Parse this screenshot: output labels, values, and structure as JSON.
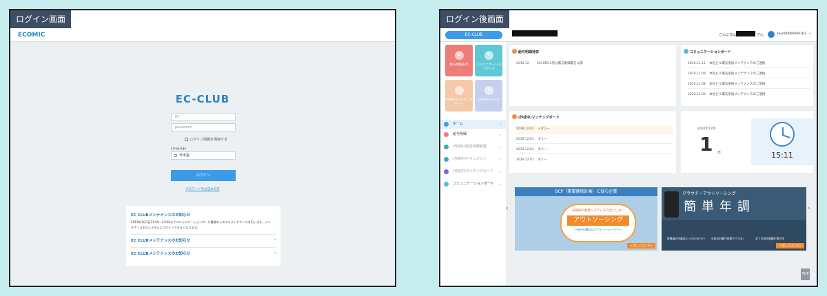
{
  "left": {
    "tag": "ログイン画面",
    "logo": "ECOMIC",
    "title": "EC-CLUB",
    "id_placeholder": "ID",
    "password_placeholder": "password",
    "remember_label": "ログイン情報を保持する",
    "language_label": "Language",
    "language_value": "日本語",
    "login_button": "ログイン",
    "forgot_link": "パスワードをお忘れの方",
    "notices": [
      {
        "title": "EC CLUBメンテナンスのお知らせ",
        "body": "2019年1月1日21:00〜24:00までコミュニケーションボード機能のシステムメンテナンスを行います。メンテナンス中はシステムにログインできなくなります。"
      },
      {
        "title": "EC CLUBメンテナンスのお知らせ"
      },
      {
        "title": "EC CLUBメンテナンスのお知らせ"
      }
    ]
  },
  "right": {
    "tag": "ログイン後画面",
    "brand": "EC-CLUB",
    "greeting_prefix": "こんにちは",
    "greeting_suffix": "さん",
    "user_id": "feu000000000163",
    "tiles": [
      {
        "label": "給与明細表示",
        "color": "#ee7c79",
        "icon": "yen-icon"
      },
      {
        "label": "コミュニケーションボード",
        "color": "#5fc8d3",
        "icon": "megaphone-icon"
      },
      {
        "label": "(作成中)マッチングボード",
        "color": "#f5c9a7",
        "icon": "chat-icon"
      },
      {
        "label": "(作成中)ヘルプ",
        "color": "#c5d0ef",
        "icon": "info-icon"
      }
    ],
    "nav": [
      {
        "label": "ホーム",
        "color": "#3c9be8",
        "active": true
      },
      {
        "label": "給与明細",
        "color": "#ee7c79"
      },
      {
        "label": "(作成中)勤怠情報管理",
        "color": "#35b3a7"
      },
      {
        "label": "(作成中)ドキュメント",
        "color": "#35b3a7"
      },
      {
        "label": "(作成中)マッチングボード",
        "color": "#6c6be0"
      },
      {
        "label": "コミュニケーションボード",
        "color": "#5fb3e5"
      }
    ],
    "payslip": {
      "title": "給与明細発表",
      "rows": [
        {
          "date": "2019.12",
          "text": "2019年12月分賞与明細書を公開"
        }
      ]
    },
    "comm": {
      "title": "コミュニケーションボード",
      "rows": [
        {
          "date": "2020.11.11",
          "text": "本社ビル電気系統メンテナンスのご連絡"
        },
        {
          "date": "2020.11.09",
          "text": "本社ビル電気系統メンテナンスのご連絡"
        },
        {
          "date": "2020.11.08",
          "text": "本社ビル電気系統メンテナンスのご連絡"
        },
        {
          "date": "2020.11.09",
          "text": "本社ビル電気系統メンテナンスのご連絡"
        }
      ]
    },
    "matching": {
      "title": "(作成中)マッチングボード",
      "rows": [
        {
          "date": "2019.12.01",
          "text": "ダミー"
        },
        {
          "date": "2019.12.01",
          "text": "ダミー"
        },
        {
          "date": "2019.12.01",
          "text": "ダミー"
        },
        {
          "date": "2019.12.01",
          "text": "ダミー"
        }
      ]
    },
    "calendar": {
      "month": "2020年12月",
      "day": "1",
      "day_suffix": "日",
      "time": "15:11"
    },
    "banner_left": {
      "headline": "BCP（事業継続計画）に悩む企業",
      "sub": "お客様の業務システムを万全にしない",
      "main": "アウトソーシング",
      "tag": "〜BCPの備えはアウトソーシングで〜",
      "more": "→ 詳しくはこちら"
    },
    "banner_right": {
      "headline": "クラウド・アウトソーシング",
      "main": "簡単年調",
      "f1": "従業員の作業はたったの3STEP!",
      "f2": "年収の計算が自動でできる!",
      "f3": "全ての申告書類を電子化",
      "more": "→ 詳しくはこちら"
    },
    "top_button": "TOP"
  }
}
